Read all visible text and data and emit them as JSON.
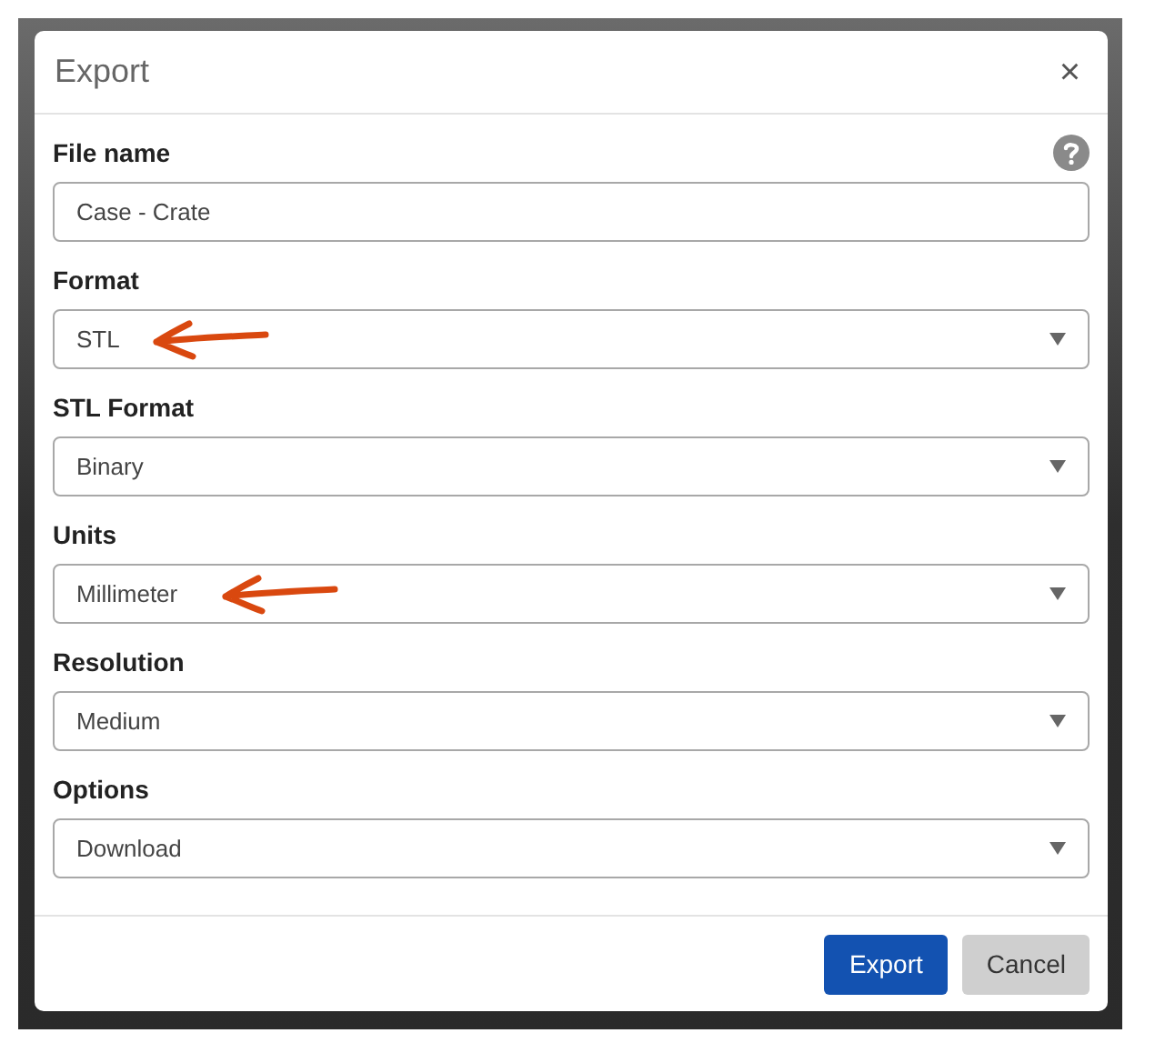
{
  "dialog": {
    "title": "Export",
    "close": "×"
  },
  "fields": [
    {
      "kind": "text",
      "label": "File name",
      "value": "Case - Crate",
      "help": true,
      "annotated": false
    },
    {
      "kind": "select",
      "label": "Format",
      "value": "STL",
      "help": false,
      "annotated": true
    },
    {
      "kind": "select",
      "label": "STL Format",
      "value": "Binary",
      "help": false,
      "annotated": false
    },
    {
      "kind": "select",
      "label": "Units",
      "value": "Millimeter",
      "help": false,
      "annotated": true
    },
    {
      "kind": "select",
      "label": "Resolution",
      "value": "Medium",
      "help": false,
      "annotated": false
    },
    {
      "kind": "select",
      "label": "Options",
      "value": "Download",
      "help": false,
      "annotated": false
    }
  ],
  "buttons": [
    {
      "label": "Export",
      "kind": "primary"
    },
    {
      "label": "Cancel",
      "kind": "secondary"
    }
  ]
}
